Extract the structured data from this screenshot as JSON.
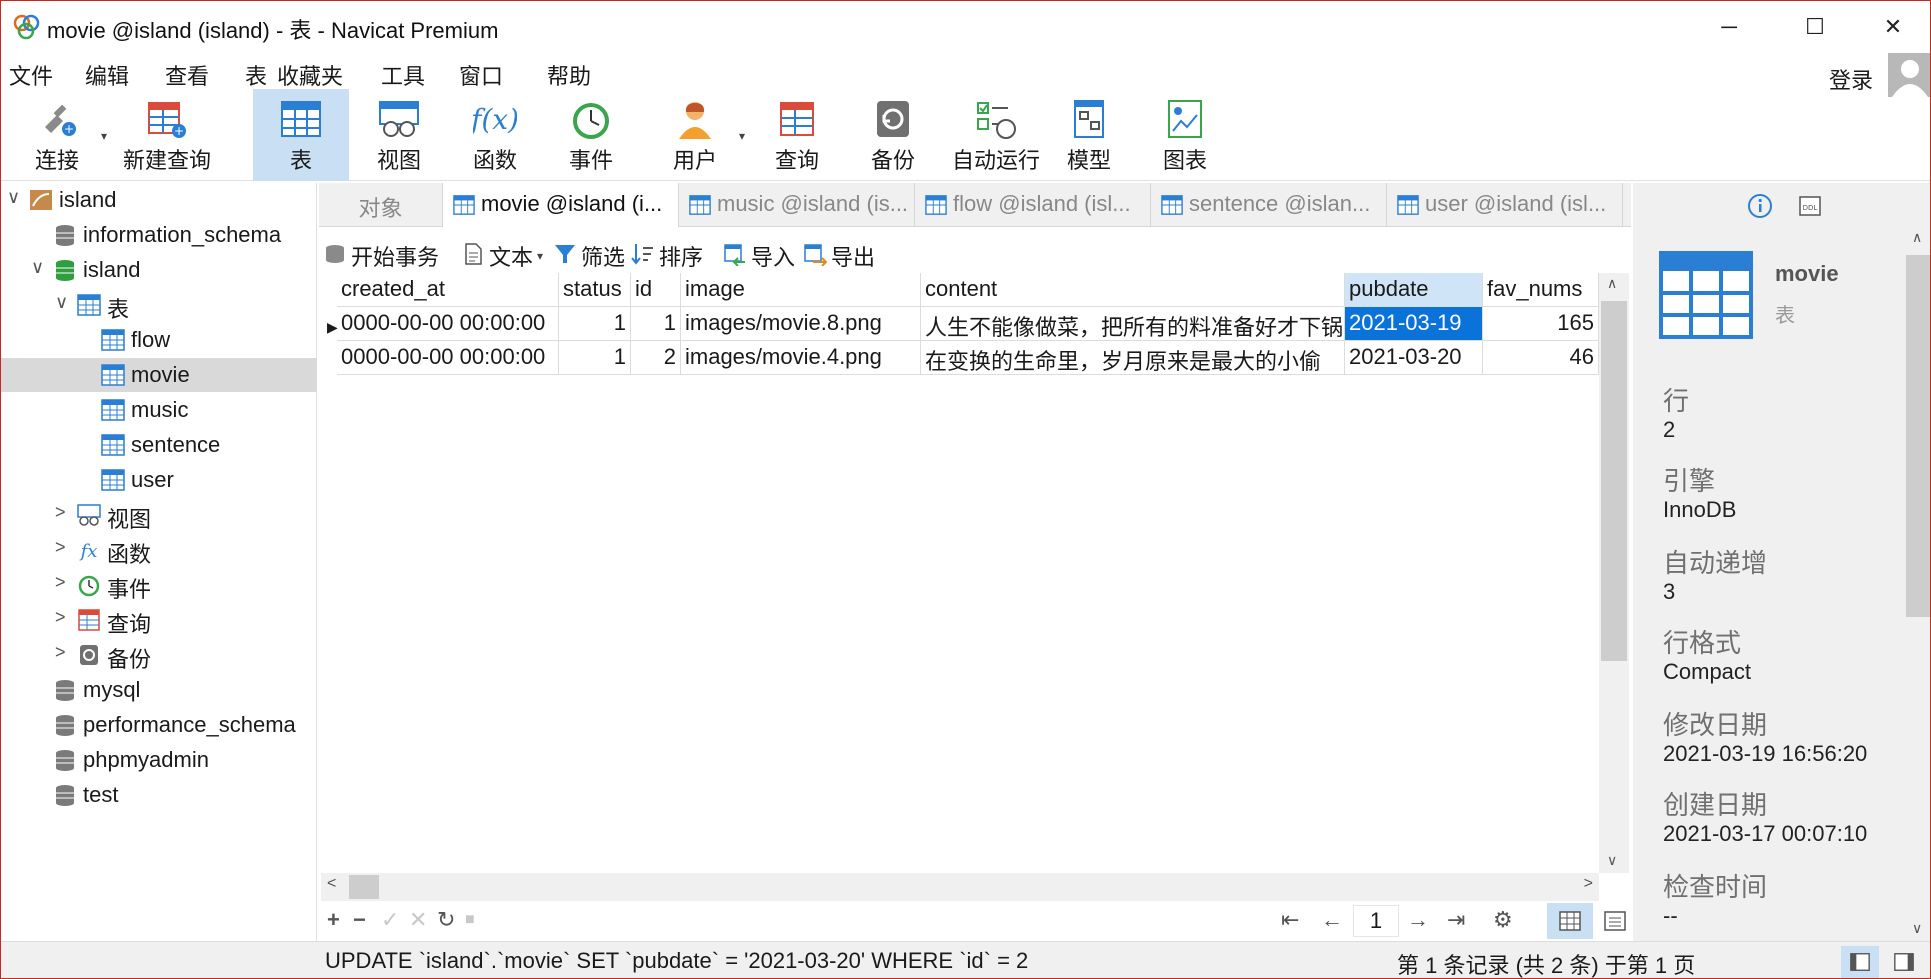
{
  "window": {
    "title": "movie @island (island) - 表 - Navicat Premium",
    "minimize_glyph": "─",
    "maximize_glyph": "☐",
    "close_glyph": "✕"
  },
  "menu": [
    "文件",
    "编辑",
    "查看",
    "表",
    "收藏夹",
    "工具",
    "窗口",
    "帮助"
  ],
  "login_label": "登录",
  "toolbar": [
    {
      "label": "连接",
      "icon": "connect-icon"
    },
    {
      "label": "新建查询",
      "icon": "new-query-icon"
    },
    {
      "label": "表",
      "icon": "table-icon",
      "active": true
    },
    {
      "label": "视图",
      "icon": "view-icon"
    },
    {
      "label": "函数",
      "icon": "function-icon"
    },
    {
      "label": "事件",
      "icon": "event-icon"
    },
    {
      "label": "用户",
      "icon": "user-icon"
    },
    {
      "label": "查询",
      "icon": "query-icon"
    },
    {
      "label": "备份",
      "icon": "backup-icon"
    },
    {
      "label": "自动运行",
      "icon": "autorun-icon"
    },
    {
      "label": "模型",
      "icon": "model-icon"
    },
    {
      "label": "图表",
      "icon": "chart-icon"
    }
  ],
  "tree": [
    {
      "label": "island",
      "level": 0,
      "arrow": "∨",
      "icon": "connection-icon"
    },
    {
      "label": "information_schema",
      "level": 1,
      "arrow": "",
      "icon": "database-icon"
    },
    {
      "label": "island",
      "level": 1,
      "arrow": "∨",
      "icon": "database-open-icon"
    },
    {
      "label": "表",
      "level": 2,
      "arrow": "∨",
      "icon": "table-group-icon"
    },
    {
      "label": "flow",
      "level": 3,
      "arrow": "",
      "icon": "table-icon"
    },
    {
      "label": "movie",
      "level": 3,
      "arrow": "",
      "icon": "table-icon",
      "selected": true
    },
    {
      "label": "music",
      "level": 3,
      "arrow": "",
      "icon": "table-icon"
    },
    {
      "label": "sentence",
      "level": 3,
      "arrow": "",
      "icon": "table-icon"
    },
    {
      "label": "user",
      "level": 3,
      "arrow": "",
      "icon": "table-icon"
    },
    {
      "label": "视图",
      "level": 2,
      "arrow": ">",
      "icon": "view-icon"
    },
    {
      "label": "函数",
      "level": 2,
      "arrow": ">",
      "icon": "function-icon"
    },
    {
      "label": "事件",
      "level": 2,
      "arrow": ">",
      "icon": "event-icon"
    },
    {
      "label": "查询",
      "level": 2,
      "arrow": ">",
      "icon": "query-icon"
    },
    {
      "label": "备份",
      "level": 2,
      "arrow": ">",
      "icon": "backup-icon"
    },
    {
      "label": "mysql",
      "level": 1,
      "arrow": "",
      "icon": "database-icon"
    },
    {
      "label": "performance_schema",
      "level": 1,
      "arrow": "",
      "icon": "database-icon"
    },
    {
      "label": "phpmyadmin",
      "level": 1,
      "arrow": "",
      "icon": "database-icon"
    },
    {
      "label": "test",
      "level": 1,
      "arrow": "",
      "icon": "database-icon"
    }
  ],
  "tabs": [
    {
      "label": "对象",
      "plain": true
    },
    {
      "label": "movie @island (i...",
      "active": true
    },
    {
      "label": "music @island (is..."
    },
    {
      "label": "flow @island (isl..."
    },
    {
      "label": "sentence @islan..."
    },
    {
      "label": "user @island (isl..."
    }
  ],
  "subtoolbar": [
    {
      "label": "开始事务",
      "icon": "transaction-icon"
    },
    {
      "label": "文本",
      "icon": "text-icon"
    },
    {
      "label": "筛选",
      "icon": "filter-icon"
    },
    {
      "label": "排序",
      "icon": "sort-icon"
    },
    {
      "label": "导入",
      "icon": "import-icon"
    },
    {
      "label": "导出",
      "icon": "export-icon"
    }
  ],
  "grid": {
    "columns": [
      "created_at",
      "status",
      "id",
      "image",
      "content",
      "pubdate",
      "fav_nums"
    ],
    "rows": [
      [
        "0000-00-00 00:00:00",
        "1",
        "1",
        "images/movie.8.png",
        "人生不能像做菜，把所有的料准备好才下锅",
        "2021-03-19",
        "165"
      ],
      [
        "0000-00-00 00:00:00",
        "1",
        "2",
        "images/movie.4.png",
        "在变换的生命里，岁月原来是最大的小偷",
        "2021-03-20",
        "46"
      ]
    ],
    "selected_row": 0,
    "selected_column": "pubdate"
  },
  "pager": {
    "page": "1",
    "add": "+",
    "remove": "−",
    "apply": "✓",
    "cancel": "✕",
    "refresh": "↻",
    "stop": "■",
    "first": "⇤",
    "prev": "←",
    "next": "→",
    "last": "⇥",
    "settings": "⚙"
  },
  "status": {
    "sql": "UPDATE `island`.`movie` SET `pubdate` = '2021-03-20' WHERE `id` = 2",
    "record_info": "第 1 条记录 (共 2 条) 于第 1 页"
  },
  "info": {
    "name": "movie",
    "type": "表",
    "fields": [
      {
        "label": "行",
        "value": "2"
      },
      {
        "label": "引擎",
        "value": "InnoDB"
      },
      {
        "label": "自动递增",
        "value": "3"
      },
      {
        "label": "行格式",
        "value": "Compact"
      },
      {
        "label": "修改日期",
        "value": "2021-03-19 16:56:20"
      },
      {
        "label": "创建日期",
        "value": "2021-03-17 00:07:10"
      },
      {
        "label": "检查时间",
        "value": "--"
      }
    ]
  },
  "colors": {
    "selection": "#0a73d9",
    "active_toolbar": "#c9dff3",
    "header_highlight": "#cfe4f7",
    "tree_selected": "#d9d9d9",
    "panel_bg": "#f0f0f0"
  }
}
